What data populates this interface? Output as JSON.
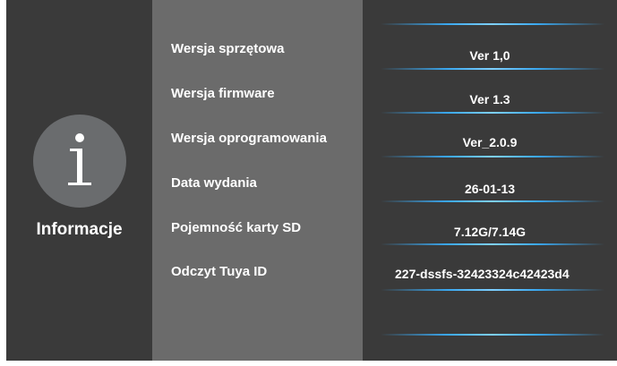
{
  "sidebar": {
    "title": "Informacje",
    "icon": "info-icon"
  },
  "rows": [
    {
      "label": "Wersja sprzętowa",
      "value": "Ver 1,0"
    },
    {
      "label": "Wersja firmware",
      "value": "Ver 1.3"
    },
    {
      "label": "Wersja oprogramowania",
      "value": "Ver_2.0.9"
    },
    {
      "label": "Data wydania",
      "value": "26-01-13"
    },
    {
      "label": "Pojemność karty SD",
      "value": "7.12G/7.14G"
    },
    {
      "label": "Odczyt Tuya ID",
      "value": "227-dssfs-32423324c42423d4"
    }
  ],
  "colors": {
    "background": "#3a3a3a",
    "label_panel": "#6b6b6b",
    "icon_circle": "#6a6c6e",
    "accent_line": "#3aa8f0"
  }
}
